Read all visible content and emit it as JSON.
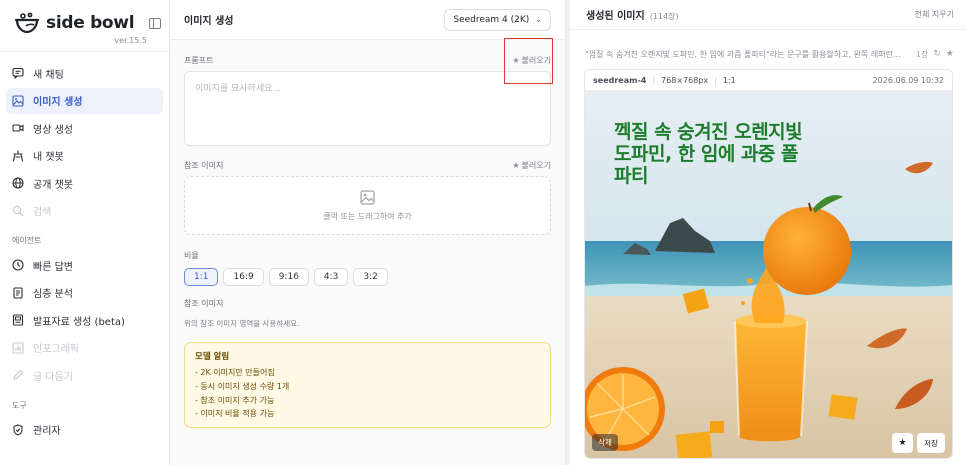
{
  "brand": {
    "name": "side bowl",
    "version": "ver.15.5"
  },
  "sidebar": {
    "items": [
      {
        "label": "새 채팅",
        "icon": "chat-icon"
      },
      {
        "label": "이미지 생성",
        "icon": "image-icon",
        "active": true
      },
      {
        "label": "영상 생성",
        "icon": "video-icon"
      },
      {
        "label": "내 챗봇",
        "icon": "bot-icon"
      },
      {
        "label": "공개 챗봇",
        "icon": "globe-icon"
      },
      {
        "label": "검색",
        "icon": "search-icon",
        "disabled": true
      }
    ],
    "agent_section": "에이전트",
    "agent_items": [
      {
        "label": "빠른 답변",
        "icon": "clock-icon"
      },
      {
        "label": "심층 분석",
        "icon": "document-icon"
      },
      {
        "label": "발표자료 생성 (beta)",
        "icon": "presentation-icon"
      },
      {
        "label": "인포그래픽",
        "icon": "chart-icon",
        "disabled": true
      },
      {
        "label": "글 다듬기",
        "icon": "pen-icon",
        "disabled": true
      }
    ],
    "tools_section": "도구",
    "tools_items": [
      {
        "label": "관리자",
        "icon": "shield-icon"
      }
    ]
  },
  "generator": {
    "title": "이미지 생성",
    "model": "Seedream 4 (2K)",
    "prompt_label": "프롬프트",
    "load_label": "불러오기",
    "prompt_placeholder": "이미지를 묘사하세요...",
    "reference_label": "참조 이미지",
    "reference_hint": "클릭 또는 드래그하여 추가",
    "ratio_label": "비율",
    "ratios": [
      "1:1",
      "16:9",
      "9:16",
      "4:3",
      "3:2"
    ],
    "selected_ratio": "1:1",
    "reference_label_2": "참조 이미지",
    "reference_help": "위의 참조 이미지 영역을 사용하세요.",
    "notice_title": "모델 알림",
    "notice_items": [
      "- 2K 이미지만 만들어짐",
      "- 동시 이미지 생성 수량 1개",
      "- 참조 이미지 추가 가능",
      "- 이미지 비율 적용 가능"
    ]
  },
  "results": {
    "title": "생성된 이미지",
    "count": "(114장)",
    "clear_all": "전체 지우기",
    "caption": "\"껍질 속 숨겨진 오렌지빛 도파민, 한 입에 과즙 폴파티\"라는 문구를 활용할하고, 왼쪽 레퍼런...",
    "caption_count": "1장",
    "card": {
      "model": "seedream-4",
      "size": "768×768px",
      "ratio": "1:1",
      "date": "2026.06.09 10:32",
      "headline": "껙질 속 숭겨진 오렌지빛 도파민, 한 임에 과중 폴파티",
      "delete_label": "삭제",
      "save_label": "저장"
    }
  },
  "colors": {
    "accent": "#3a5bc7",
    "highlight": "#e03a2f",
    "notice_bg": "#fff9e5"
  }
}
